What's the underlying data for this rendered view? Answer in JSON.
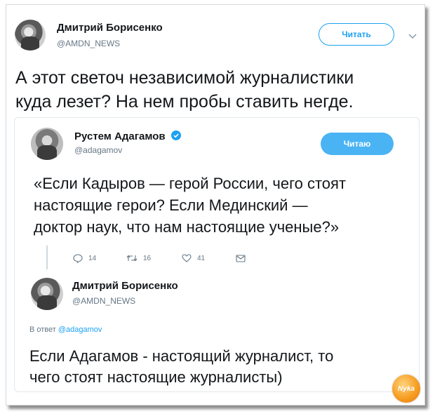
{
  "main_tweet": {
    "author_name": "Дмитрий Борисенко",
    "author_handle": "@AMDN_NEWS",
    "follow_label": "Читать",
    "text_line1": "А этот светоч независимой журналистики",
    "text_line2": "куда лезет? На нем пробы ставить негде."
  },
  "quoted_tweet": {
    "author_name": "Рустем Адагамов",
    "author_handle": "@adagamov",
    "follow_label": "Читаю",
    "text_line1": "«Если Кадыров — герой России, чего стоят",
    "text_line2": "настоящие герои? Если Мединский —",
    "text_line3": "доктор наук, что нам настоящие ученые?»",
    "actions": {
      "replies": "14",
      "retweets": "16",
      "likes": "41"
    }
  },
  "reply_tweet": {
    "author_name": "Дмитрий Борисенко",
    "author_handle": "@AMDN_NEWS",
    "reply_to_prefix": "В ответ",
    "reply_to_handle": "@adagamov",
    "text_line1": "Если Адагамов - настоящий журналист, то",
    "text_line2": "чего стоят настоящие журналисты)"
  },
  "watermark": {
    "label": "Nyka"
  },
  "colors": {
    "accent": "#1da1f2",
    "button_fill": "#4ab3f4",
    "secondary_text": "#657786",
    "primary_text": "#14171a"
  },
  "icons": [
    "chevron-down-icon",
    "verified-badge-icon",
    "reply-icon",
    "retweet-icon",
    "like-icon",
    "message-icon"
  ]
}
